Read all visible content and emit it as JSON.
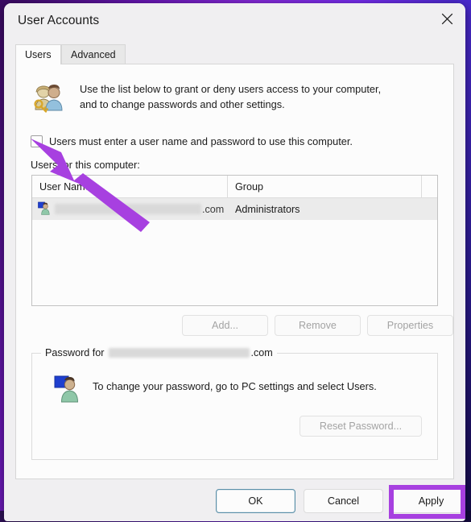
{
  "window": {
    "title": "User Accounts",
    "close_icon": "close-icon"
  },
  "tabs": [
    {
      "label": "Users",
      "active": true
    },
    {
      "label": "Advanced",
      "active": false
    }
  ],
  "users_tab": {
    "blurb_line1": "Use the list below to grant or deny users access to your computer,",
    "blurb_line2": "and to change passwords and other settings.",
    "blurb_icon": "users-with-key-icon",
    "checkbox": {
      "label": "Users must enter a user name and password to use this computer.",
      "checked": false
    },
    "list_label": "Users for this computer:",
    "list": {
      "columns": [
        "User Name",
        "Group",
        ""
      ],
      "rows": [
        {
          "user_icon": "user-account-icon",
          "user_name_redacted": true,
          "user_name_suffix": ".com",
          "group": "Administrators",
          "selected": true
        }
      ]
    },
    "buttons": {
      "add": {
        "label": "Add...",
        "disabled": true
      },
      "remove": {
        "label": "Remove",
        "disabled": true
      },
      "properties": {
        "label": "Properties",
        "disabled": true
      }
    },
    "password_group": {
      "legend_prefix": "Password for",
      "legend_redacted": true,
      "legend_suffix": ".com",
      "icon": "user-password-icon",
      "text": "To change your password, go to PC settings and select Users.",
      "reset_button": {
        "label": "Reset Password...",
        "disabled": true
      }
    }
  },
  "footer": {
    "ok": "OK",
    "cancel": "Cancel",
    "apply": "Apply"
  },
  "annotations": {
    "color": "#a740e0",
    "arrow_target": "users-must-enter-checkbox",
    "highlight_target": "apply-button"
  }
}
